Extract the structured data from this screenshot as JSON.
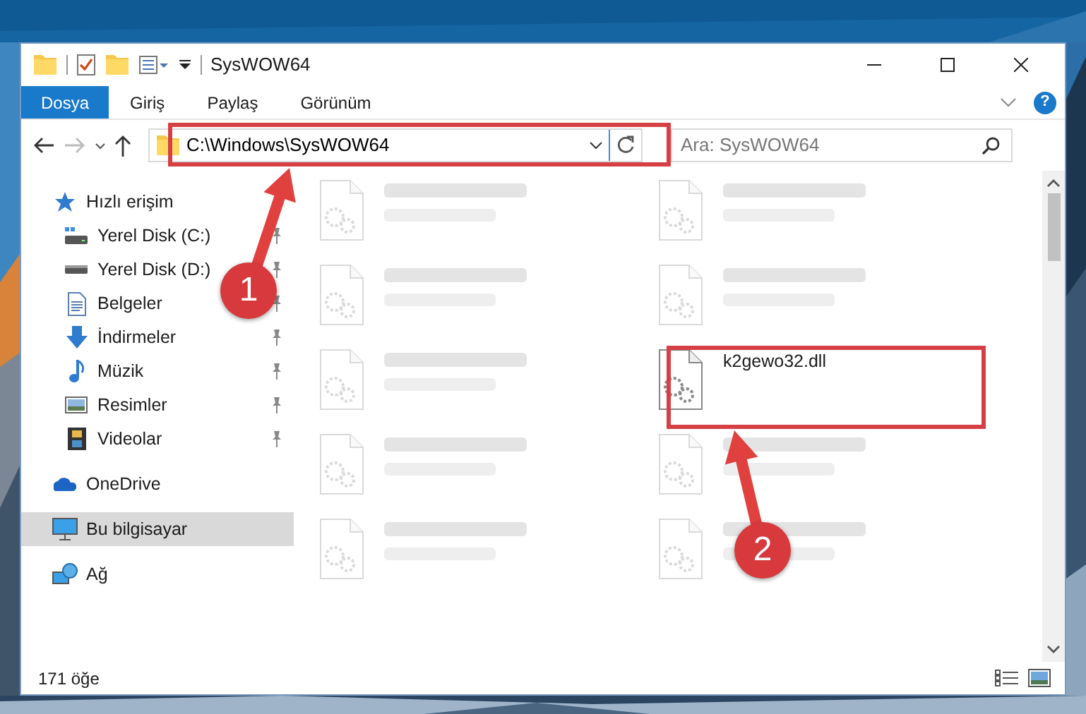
{
  "window": {
    "title": "SysWOW64"
  },
  "ribbon": {
    "tabs": [
      {
        "label": "Dosya",
        "selected": true
      },
      {
        "label": "Giriş",
        "selected": false
      },
      {
        "label": "Paylaş",
        "selected": false
      },
      {
        "label": "Görünüm",
        "selected": false
      }
    ],
    "help": "?"
  },
  "address": {
    "path": "C:\\Windows\\SysWOW64"
  },
  "search": {
    "placeholder": "Ara: SysWOW64"
  },
  "sidebar": {
    "items": [
      {
        "kind": "section",
        "label": "Hızlı erişim",
        "selected": false
      },
      {
        "kind": "item",
        "label": "Yerel Disk (C:)",
        "pinned": true,
        "selected": false
      },
      {
        "kind": "item",
        "label": "Yerel Disk (D:)",
        "pinned": true,
        "selected": false
      },
      {
        "kind": "item",
        "label": "Belgeler",
        "pinned": true,
        "selected": false
      },
      {
        "kind": "item",
        "label": "İndirmeler",
        "pinned": true,
        "selected": false
      },
      {
        "kind": "item",
        "label": "Müzik",
        "pinned": true,
        "selected": false
      },
      {
        "kind": "item",
        "label": "Resimler",
        "pinned": true,
        "selected": false
      },
      {
        "kind": "item",
        "label": "Videolar",
        "pinned": true,
        "selected": false
      },
      {
        "kind": "section",
        "label": "OneDrive",
        "selected": false
      },
      {
        "kind": "section",
        "label": "Bu bilgisayar",
        "selected": true
      },
      {
        "kind": "section",
        "label": "Ağ",
        "selected": false
      }
    ]
  },
  "files": [
    {
      "dimmed": true
    },
    {
      "dimmed": true
    },
    {
      "dimmed": true
    },
    {
      "dimmed": true
    },
    {
      "dimmed": true
    },
    {
      "name": "k2gewo32.dll",
      "dimmed": false
    },
    {
      "dimmed": true
    },
    {
      "dimmed": true
    },
    {
      "dimmed": true
    },
    {
      "dimmed": true
    }
  ],
  "status_bar": {
    "count": "171 öğe"
  },
  "annotations": [
    {
      "label": "1"
    },
    {
      "label": "2"
    }
  ]
}
